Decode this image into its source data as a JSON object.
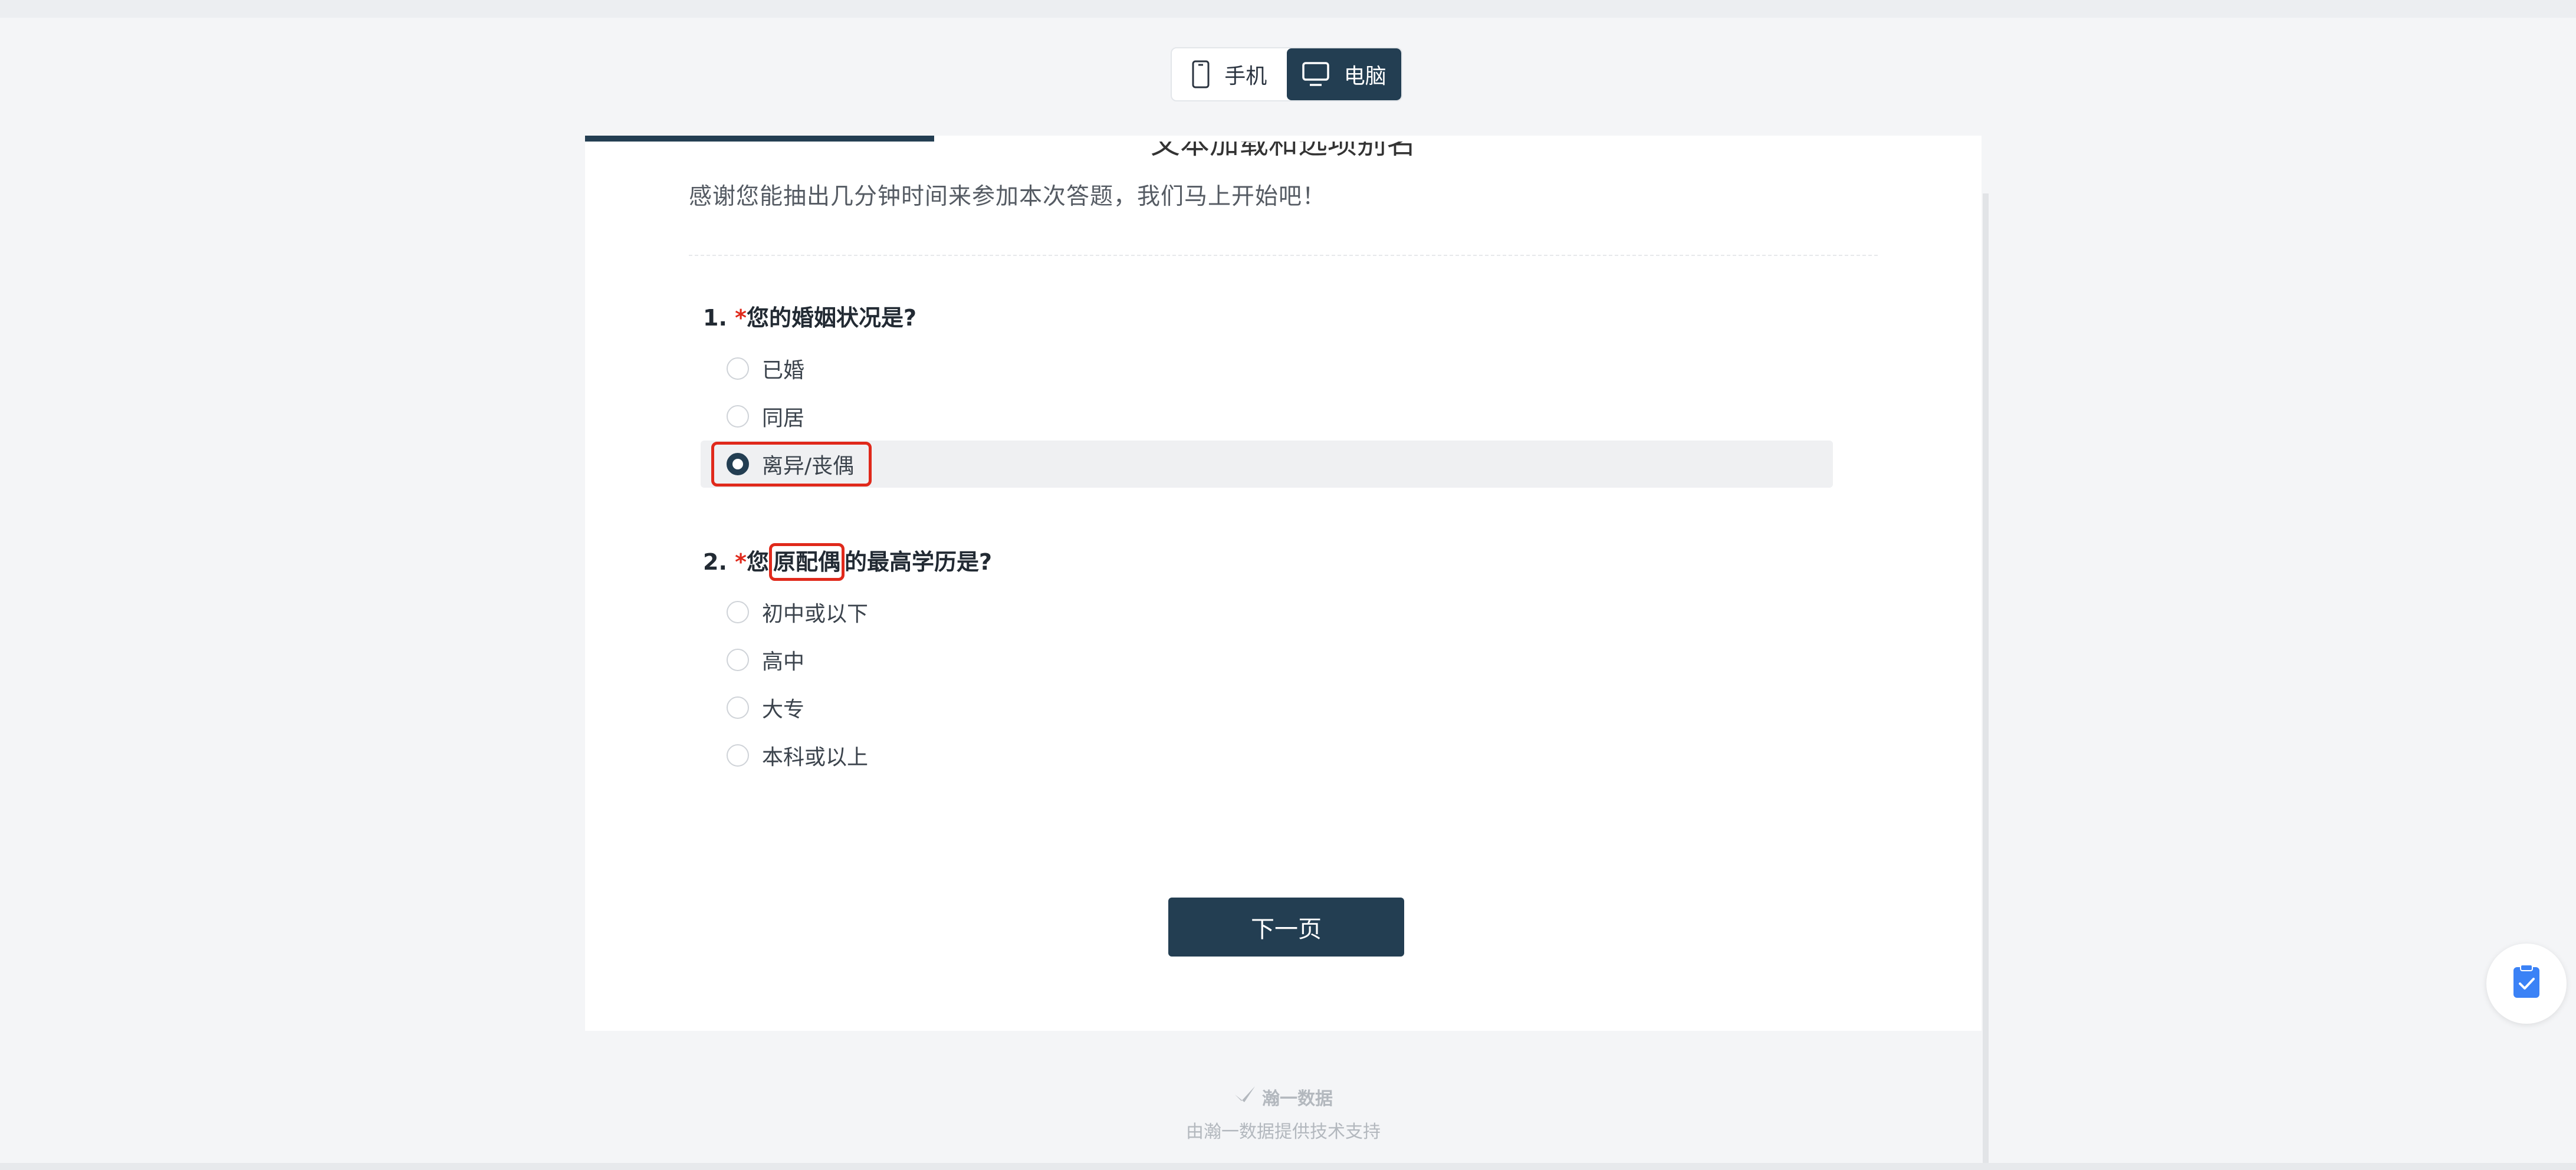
{
  "device_toggle": {
    "mobile_label": "手机",
    "desktop_label": "电脑",
    "active": "desktop"
  },
  "survey": {
    "title": "文本加载和选项别名",
    "intro": "感谢您能抽出几分钟时间来参加本次答题，我们马上开始吧！",
    "progress": 0.25
  },
  "questions": [
    {
      "number": "1.",
      "required_mark": "*",
      "text": "您的婚姻状况是?",
      "options": [
        {
          "label": "已婚",
          "selected": false
        },
        {
          "label": "同居",
          "selected": false
        },
        {
          "label": "离异/丧偶",
          "selected": true
        }
      ]
    },
    {
      "number": "2.",
      "required_mark": "*",
      "text_before": "您",
      "text_highlight": "原配偶",
      "text_after": "的最高学历是?",
      "options": [
        {
          "label": "初中或以下",
          "selected": false
        },
        {
          "label": "高中",
          "selected": false
        },
        {
          "label": "大专",
          "selected": false
        },
        {
          "label": "本科或以上",
          "selected": false
        }
      ]
    }
  ],
  "next_button_label": "下一页",
  "footer": {
    "brand": "瀚一数据",
    "support": "由瀚一数据提供技术支持"
  },
  "colors": {
    "primary": "#233e52",
    "required": "#e0291b",
    "float_icon": "#3b82f6"
  },
  "icons": {
    "mobile": "phone-icon",
    "desktop": "monitor-icon",
    "brand": "check-logo-icon",
    "float": "clipboard-check-icon"
  }
}
